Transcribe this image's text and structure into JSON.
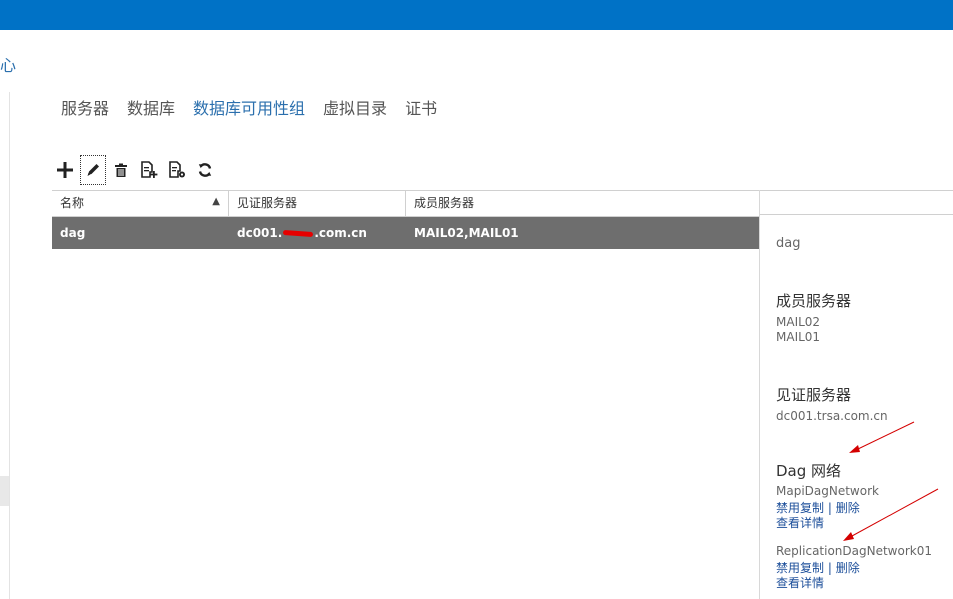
{
  "colors": {
    "topbar": "#0072c6",
    "tab_active": "#2b6fad",
    "row_selected": "#6e6e6e",
    "link": "#1d4f9a",
    "annotation": "#d40000"
  },
  "breadcrumb_fragment": "心",
  "tabs": [
    {
      "label": "服务器"
    },
    {
      "label": "数据库"
    },
    {
      "label": "数据库可用性组",
      "active": true
    },
    {
      "label": "虚拟目录"
    },
    {
      "label": "证书"
    }
  ],
  "toolbar": {
    "icons": [
      "add-icon",
      "edit-icon",
      "delete-icon",
      "add-server-icon",
      "manage-network-icon",
      "refresh-icon"
    ]
  },
  "grid": {
    "columns": [
      "名称",
      "见证服务器",
      "成员服务器"
    ],
    "rows": [
      {
        "name": "dag",
        "witness_prefix": "dc001.",
        "witness_suffix": ".com.cn",
        "members": "MAIL02,MAIL01"
      }
    ]
  },
  "details": {
    "name": "dag",
    "members_title": "成员服务器",
    "members": [
      "MAIL02",
      "MAIL01"
    ],
    "witness_title": "见证服务器",
    "witness": "dc001.trsa.com.cn",
    "networks_title": "Dag 网络",
    "networks": [
      {
        "name": "MapiDagNetwork",
        "disable": "禁用复制",
        "sep": "|",
        "delete": "删除",
        "view": "查看详情"
      },
      {
        "name": "ReplicationDagNetwork01",
        "disable": "禁用复制",
        "sep": "|",
        "delete": "删除",
        "view": "查看详情"
      }
    ]
  }
}
